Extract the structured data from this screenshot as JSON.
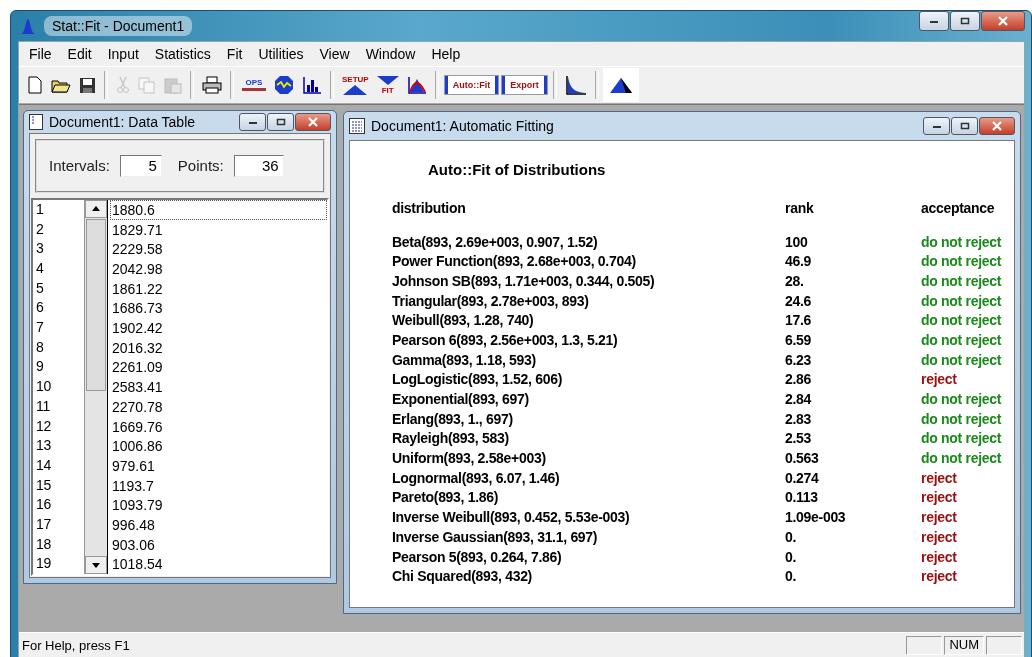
{
  "window": {
    "title": "Stat::Fit - Document1"
  },
  "menu": [
    "File",
    "Edit",
    "Input",
    "Statistics",
    "Fit",
    "Utilities",
    "View",
    "Window",
    "Help"
  ],
  "toolbar": [
    {
      "kind": "new",
      "disabled": false
    },
    {
      "kind": "open",
      "disabled": false
    },
    {
      "kind": "save",
      "disabled": false
    },
    {
      "kind": "sep"
    },
    {
      "kind": "cut",
      "disabled": true
    },
    {
      "kind": "copy",
      "disabled": true
    },
    {
      "kind": "paste",
      "disabled": true
    },
    {
      "kind": "sep"
    },
    {
      "kind": "print",
      "disabled": false
    },
    {
      "kind": "sep"
    },
    {
      "kind": "ops",
      "label": "OPS",
      "disabled": false
    },
    {
      "kind": "octagon",
      "disabled": false
    },
    {
      "kind": "histogram",
      "disabled": false
    },
    {
      "kind": "sep"
    },
    {
      "kind": "setup",
      "label": "SETUP",
      "disabled": false
    },
    {
      "kind": "fit",
      "label": "FIT",
      "disabled": false
    },
    {
      "kind": "compare",
      "disabled": false
    },
    {
      "kind": "sep"
    },
    {
      "kind": "textbutton",
      "label": "Auto::Fit",
      "disabled": false
    },
    {
      "kind": "textbutton",
      "label": "Export",
      "disabled": false
    },
    {
      "kind": "sep"
    },
    {
      "kind": "curve",
      "disabled": false
    },
    {
      "kind": "sep"
    },
    {
      "kind": "peak",
      "disabled": false
    }
  ],
  "data_table": {
    "title": "Document1: Data Table",
    "intervals_label": "Intervals:",
    "intervals": "5",
    "points_label": "Points:",
    "points": "36",
    "rows": [
      {
        "index": "1",
        "value": "1880.6",
        "selected": true
      },
      {
        "index": "2",
        "value": "1829.71",
        "selected": false
      },
      {
        "index": "3",
        "value": "2229.58",
        "selected": false
      },
      {
        "index": "4",
        "value": "2042.98",
        "selected": false
      },
      {
        "index": "5",
        "value": "1861.22",
        "selected": false
      },
      {
        "index": "6",
        "value": "1686.73",
        "selected": false
      },
      {
        "index": "7",
        "value": "1902.42",
        "selected": false
      },
      {
        "index": "8",
        "value": "2016.32",
        "selected": false
      },
      {
        "index": "9",
        "value": "2261.09",
        "selected": false
      },
      {
        "index": "10",
        "value": "2583.41",
        "selected": false
      },
      {
        "index": "11",
        "value": "2270.78",
        "selected": false
      },
      {
        "index": "12",
        "value": "1669.76",
        "selected": false
      },
      {
        "index": "13",
        "value": "1006.86",
        "selected": false
      },
      {
        "index": "14",
        "value": "979.61",
        "selected": false
      },
      {
        "index": "15",
        "value": "1193.7",
        "selected": false
      },
      {
        "index": "16",
        "value": "1093.79",
        "selected": false
      },
      {
        "index": "17",
        "value": "996.48",
        "selected": false
      },
      {
        "index": "18",
        "value": "903.06",
        "selected": false
      },
      {
        "index": "19",
        "value": "1018.54",
        "selected": false
      }
    ]
  },
  "fitting": {
    "title": "Document1: Automatic Fitting",
    "heading": "Auto::Fit of Distributions",
    "columns": [
      "distribution",
      "rank",
      "acceptance"
    ],
    "rows": [
      {
        "distribution": "Beta(893, 2.69e+003, 0.907, 1.52)",
        "rank": "100",
        "acceptance": "do not reject",
        "rejected": false
      },
      {
        "distribution": "Power Function(893, 2.68e+003, 0.704)",
        "rank": "46.9",
        "acceptance": "do not reject",
        "rejected": false
      },
      {
        "distribution": "Johnson SB(893, 1.71e+003, 0.344, 0.505)",
        "rank": "28.",
        "acceptance": "do not reject",
        "rejected": false
      },
      {
        "distribution": "Triangular(893, 2.78e+003, 893)",
        "rank": "24.6",
        "acceptance": "do not reject",
        "rejected": false
      },
      {
        "distribution": "Weibull(893, 1.28, 740)",
        "rank": "17.6",
        "acceptance": "do not reject",
        "rejected": false
      },
      {
        "distribution": "Pearson 6(893, 2.56e+003, 1.3, 5.21)",
        "rank": "6.59",
        "acceptance": "do not reject",
        "rejected": false
      },
      {
        "distribution": "Gamma(893, 1.18, 593)",
        "rank": "6.23",
        "acceptance": "do not reject",
        "rejected": false
      },
      {
        "distribution": "LogLogistic(893, 1.52, 606)",
        "rank": "2.86",
        "acceptance": "reject",
        "rejected": true
      },
      {
        "distribution": "Exponential(893, 697)",
        "rank": "2.84",
        "acceptance": "do not reject",
        "rejected": false
      },
      {
        "distribution": "Erlang(893, 1., 697)",
        "rank": "2.83",
        "acceptance": "do not reject",
        "rejected": false
      },
      {
        "distribution": "Rayleigh(893, 583)",
        "rank": "2.53",
        "acceptance": "do not reject",
        "rejected": false
      },
      {
        "distribution": "Uniform(893, 2.58e+003)",
        "rank": "0.563",
        "acceptance": "do not reject",
        "rejected": false
      },
      {
        "distribution": "Lognormal(893, 6.07, 1.46)",
        "rank": "0.274",
        "acceptance": "reject",
        "rejected": true
      },
      {
        "distribution": "Pareto(893, 1.86)",
        "rank": "0.113",
        "acceptance": "reject",
        "rejected": true
      },
      {
        "distribution": "Inverse Weibull(893, 0.452, 5.53e-003)",
        "rank": "1.09e-003",
        "acceptance": "reject",
        "rejected": true
      },
      {
        "distribution": "Inverse Gaussian(893, 31.1, 697)",
        "rank": "0.",
        "acceptance": "reject",
        "rejected": true
      },
      {
        "distribution": "Pearson 5(893, 0.264, 7.86)",
        "rank": "0.",
        "acceptance": "reject",
        "rejected": true
      },
      {
        "distribution": "Chi Squared(893, 432)",
        "rank": "0.",
        "acceptance": "reject",
        "rejected": true
      }
    ]
  },
  "status_bar": {
    "text": "For Help, press F1",
    "indicators": [
      {
        "kind": "empty"
      },
      {
        "kind": "text",
        "text": "NUM"
      },
      {
        "kind": "empty"
      }
    ]
  }
}
